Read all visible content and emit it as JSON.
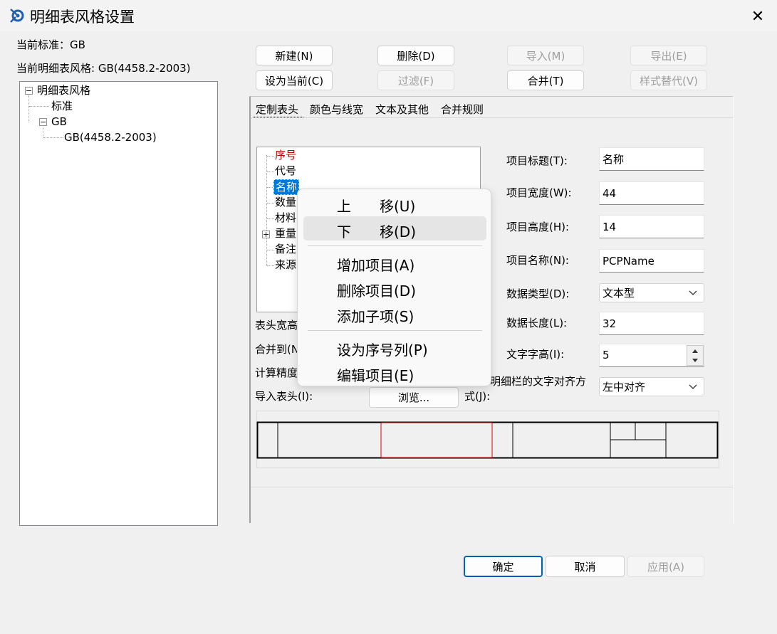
{
  "window": {
    "title": "明细表风格设置",
    "close_glyph": "✕"
  },
  "info": {
    "current_standard": "当前标准：GB",
    "current_style": "当前明细表风格: GB(4458.2-2003)"
  },
  "style_tree": {
    "root": "明细表风格",
    "children": [
      "标准",
      "GB"
    ],
    "grandchild": "GB(4458.2-2003)",
    "collapse_glyph": "−"
  },
  "toolbar": {
    "new": "新建(N)",
    "delete": "删除(D)",
    "import": "导入(M)",
    "export": "导出(E)",
    "set_current": "设为当前(C)",
    "filter": "过滤(F)",
    "merge": "合并(T)",
    "replace_style": "样式替代(V)"
  },
  "tabs": [
    "定制表头",
    "颜色与线宽",
    "文本及其他",
    "合并规则"
  ],
  "item_tree": {
    "items": [
      "序号",
      "代号",
      "名称",
      "数量",
      "材料",
      "重量",
      "备注",
      "来源"
    ],
    "selected_index": 2,
    "expand_glyph": "+",
    "accent_color": "#c00000"
  },
  "left_labels": {
    "header_width": "表头宽高",
    "merge_to": "合并到(N",
    "calc_precision": "计算精度",
    "import_header": "导入表头(I):",
    "browse": "浏览..."
  },
  "props": {
    "title_label": "项目标题(T):",
    "title_value": "名称",
    "width_label": "项目宽度(W):",
    "width_value": "44",
    "height_label": "项目高度(H):",
    "height_value": "14",
    "name_label": "项目名称(N):",
    "name_value": "PCPName",
    "datatype_label": "数据类型(D):",
    "datatype_value": "文本型",
    "datalen_label": "数据长度(L):",
    "datalen_value": "32",
    "fontsize_label": "文字字高(I):",
    "fontsize_value": "5",
    "align_label_line1": "明细栏的文字对齐方",
    "align_label_line2": "式(J):",
    "align_value": "左中对齐"
  },
  "context_menu": {
    "items": [
      "上　　移(U)",
      "下　　移(D)",
      "增加项目(A)",
      "删除项目(D)",
      "添加子项(S)",
      "设为序号列(P)",
      "编辑项目(E)"
    ],
    "highlighted_index": 1
  },
  "footer": {
    "ok": "确定",
    "cancel": "取消",
    "apply": "应用(A)"
  }
}
